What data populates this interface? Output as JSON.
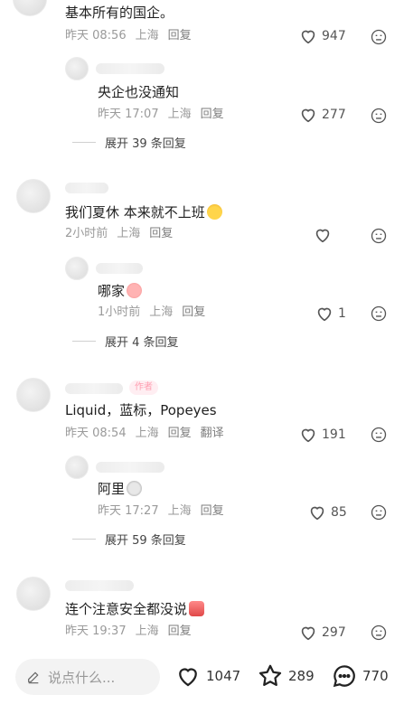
{
  "comments": [
    {
      "text": "基本所有的国企。",
      "time": "昨天 08:56",
      "location": "上海",
      "reply_label": "回复",
      "likes": "947"
    },
    {
      "text": "央企也没通知",
      "time": "昨天 17:07",
      "location": "上海",
      "reply_label": "回复",
      "likes": "277"
    },
    {
      "text": "我们夏休 本来就不上班",
      "time": "2小时前",
      "location": "上海",
      "reply_label": "回复",
      "likes": ""
    },
    {
      "text": "哪家",
      "time": "1小时前",
      "location": "上海",
      "reply_label": "回复",
      "likes": "1"
    },
    {
      "text": "Liquid，蓝标，Popeyes",
      "time": "昨天 08:54",
      "location": "上海",
      "reply_label": "回复",
      "translate_label": "翻译",
      "likes": "191",
      "author_tag": "作者"
    },
    {
      "text": "阿里",
      "time": "昨天 17:27",
      "location": "上海",
      "reply_label": "回复",
      "likes": "85"
    },
    {
      "text": "连个注意安全都没说",
      "time": "昨天 19:37",
      "location": "上海",
      "reply_label": "回复",
      "likes": "297"
    }
  ],
  "expanders": [
    {
      "label": "展开 39 条回复"
    },
    {
      "label": "展开 4 条回复"
    },
    {
      "label": "展开 59 条回复"
    }
  ],
  "bottom_bar": {
    "input_placeholder": "说点什么...",
    "like_count": "1047",
    "star_count": "289",
    "comment_count": "770"
  },
  "icons": {
    "like": "heart-icon",
    "dislike": "neutral-face-icon",
    "edit": "pencil-icon",
    "star": "star-icon",
    "comment": "chat-bubble-icon"
  },
  "colors": {
    "text": "#1f1f1f",
    "meta": "#9a9a9a",
    "author_tag_bg": "#ffeef2",
    "author_tag_text": "#ff9db0"
  }
}
